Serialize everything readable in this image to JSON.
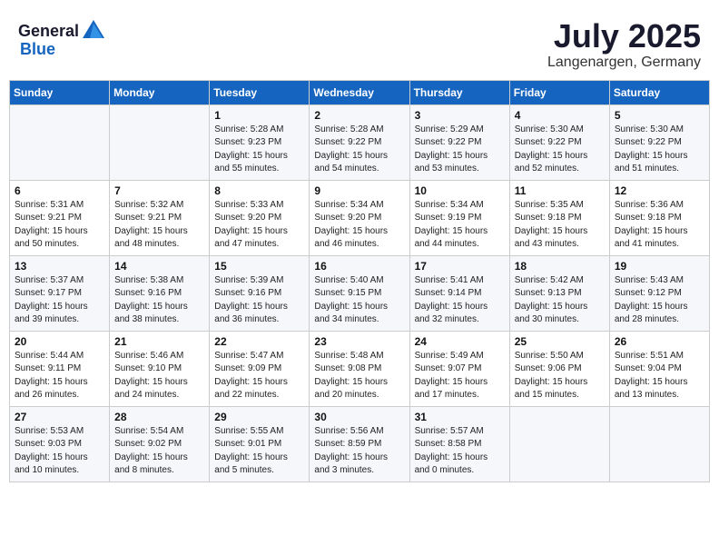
{
  "header": {
    "logo_general": "General",
    "logo_blue": "Blue",
    "month": "July 2025",
    "location": "Langenargen, Germany"
  },
  "weekdays": [
    "Sunday",
    "Monday",
    "Tuesday",
    "Wednesday",
    "Thursday",
    "Friday",
    "Saturday"
  ],
  "weeks": [
    [
      {
        "day": "",
        "info": ""
      },
      {
        "day": "",
        "info": ""
      },
      {
        "day": "1",
        "info": "Sunrise: 5:28 AM\nSunset: 9:23 PM\nDaylight: 15 hours\nand 55 minutes."
      },
      {
        "day": "2",
        "info": "Sunrise: 5:28 AM\nSunset: 9:22 PM\nDaylight: 15 hours\nand 54 minutes."
      },
      {
        "day": "3",
        "info": "Sunrise: 5:29 AM\nSunset: 9:22 PM\nDaylight: 15 hours\nand 53 minutes."
      },
      {
        "day": "4",
        "info": "Sunrise: 5:30 AM\nSunset: 9:22 PM\nDaylight: 15 hours\nand 52 minutes."
      },
      {
        "day": "5",
        "info": "Sunrise: 5:30 AM\nSunset: 9:22 PM\nDaylight: 15 hours\nand 51 minutes."
      }
    ],
    [
      {
        "day": "6",
        "info": "Sunrise: 5:31 AM\nSunset: 9:21 PM\nDaylight: 15 hours\nand 50 minutes."
      },
      {
        "day": "7",
        "info": "Sunrise: 5:32 AM\nSunset: 9:21 PM\nDaylight: 15 hours\nand 48 minutes."
      },
      {
        "day": "8",
        "info": "Sunrise: 5:33 AM\nSunset: 9:20 PM\nDaylight: 15 hours\nand 47 minutes."
      },
      {
        "day": "9",
        "info": "Sunrise: 5:34 AM\nSunset: 9:20 PM\nDaylight: 15 hours\nand 46 minutes."
      },
      {
        "day": "10",
        "info": "Sunrise: 5:34 AM\nSunset: 9:19 PM\nDaylight: 15 hours\nand 44 minutes."
      },
      {
        "day": "11",
        "info": "Sunrise: 5:35 AM\nSunset: 9:18 PM\nDaylight: 15 hours\nand 43 minutes."
      },
      {
        "day": "12",
        "info": "Sunrise: 5:36 AM\nSunset: 9:18 PM\nDaylight: 15 hours\nand 41 minutes."
      }
    ],
    [
      {
        "day": "13",
        "info": "Sunrise: 5:37 AM\nSunset: 9:17 PM\nDaylight: 15 hours\nand 39 minutes."
      },
      {
        "day": "14",
        "info": "Sunrise: 5:38 AM\nSunset: 9:16 PM\nDaylight: 15 hours\nand 38 minutes."
      },
      {
        "day": "15",
        "info": "Sunrise: 5:39 AM\nSunset: 9:16 PM\nDaylight: 15 hours\nand 36 minutes."
      },
      {
        "day": "16",
        "info": "Sunrise: 5:40 AM\nSunset: 9:15 PM\nDaylight: 15 hours\nand 34 minutes."
      },
      {
        "day": "17",
        "info": "Sunrise: 5:41 AM\nSunset: 9:14 PM\nDaylight: 15 hours\nand 32 minutes."
      },
      {
        "day": "18",
        "info": "Sunrise: 5:42 AM\nSunset: 9:13 PM\nDaylight: 15 hours\nand 30 minutes."
      },
      {
        "day": "19",
        "info": "Sunrise: 5:43 AM\nSunset: 9:12 PM\nDaylight: 15 hours\nand 28 minutes."
      }
    ],
    [
      {
        "day": "20",
        "info": "Sunrise: 5:44 AM\nSunset: 9:11 PM\nDaylight: 15 hours\nand 26 minutes."
      },
      {
        "day": "21",
        "info": "Sunrise: 5:46 AM\nSunset: 9:10 PM\nDaylight: 15 hours\nand 24 minutes."
      },
      {
        "day": "22",
        "info": "Sunrise: 5:47 AM\nSunset: 9:09 PM\nDaylight: 15 hours\nand 22 minutes."
      },
      {
        "day": "23",
        "info": "Sunrise: 5:48 AM\nSunset: 9:08 PM\nDaylight: 15 hours\nand 20 minutes."
      },
      {
        "day": "24",
        "info": "Sunrise: 5:49 AM\nSunset: 9:07 PM\nDaylight: 15 hours\nand 17 minutes."
      },
      {
        "day": "25",
        "info": "Sunrise: 5:50 AM\nSunset: 9:06 PM\nDaylight: 15 hours\nand 15 minutes."
      },
      {
        "day": "26",
        "info": "Sunrise: 5:51 AM\nSunset: 9:04 PM\nDaylight: 15 hours\nand 13 minutes."
      }
    ],
    [
      {
        "day": "27",
        "info": "Sunrise: 5:53 AM\nSunset: 9:03 PM\nDaylight: 15 hours\nand 10 minutes."
      },
      {
        "day": "28",
        "info": "Sunrise: 5:54 AM\nSunset: 9:02 PM\nDaylight: 15 hours\nand 8 minutes."
      },
      {
        "day": "29",
        "info": "Sunrise: 5:55 AM\nSunset: 9:01 PM\nDaylight: 15 hours\nand 5 minutes."
      },
      {
        "day": "30",
        "info": "Sunrise: 5:56 AM\nSunset: 8:59 PM\nDaylight: 15 hours\nand 3 minutes."
      },
      {
        "day": "31",
        "info": "Sunrise: 5:57 AM\nSunset: 8:58 PM\nDaylight: 15 hours\nand 0 minutes."
      },
      {
        "day": "",
        "info": ""
      },
      {
        "day": "",
        "info": ""
      }
    ]
  ]
}
